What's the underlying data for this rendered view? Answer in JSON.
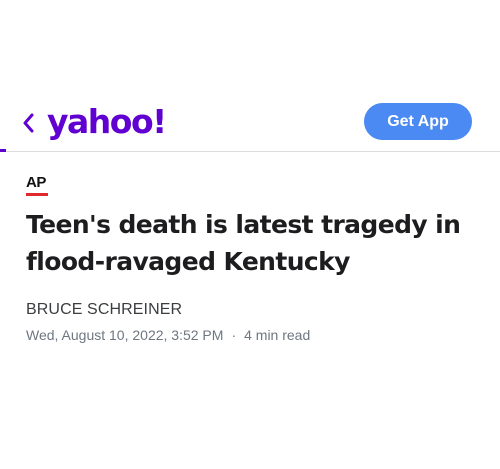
{
  "header": {
    "logo_text": "yahoo!",
    "get_app_label": "Get App",
    "brand_color": "#6001d2",
    "button_color": "#4b8af2"
  },
  "article": {
    "provider": "AP",
    "headline": "Teen's death is latest tragedy in flood-ravaged Kentucky",
    "author": "BRUCE SCHREINER",
    "date": "Wed, August 10, 2022, 3:52 PM",
    "separator": "·",
    "read_time": "4 min read"
  },
  "icons": {
    "back": "chevron-left-icon"
  }
}
